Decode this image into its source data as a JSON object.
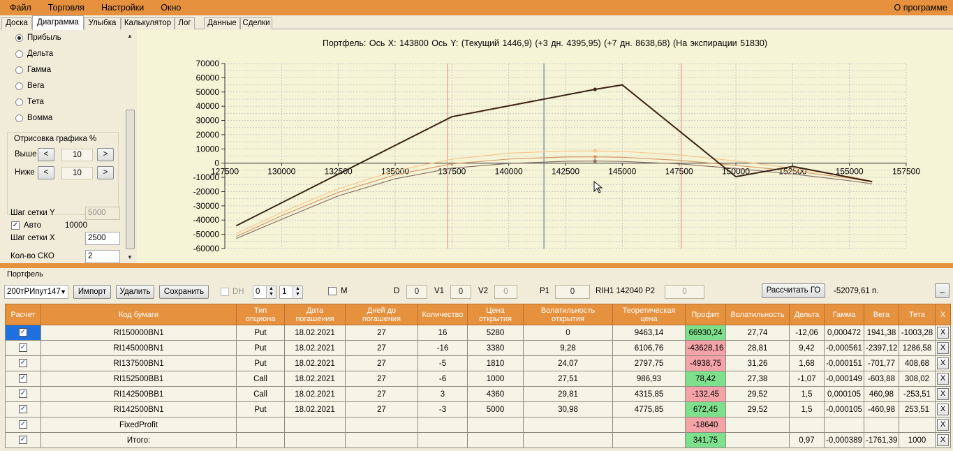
{
  "menu": {
    "items": [
      "Файл",
      "Торговля",
      "Настройки",
      "Окно"
    ],
    "about": "О программе"
  },
  "tabs": [
    "Доска",
    "Диаграмма",
    "Улыбка",
    "Калькулятор",
    "Лог",
    "Данные",
    "Сделки"
  ],
  "active_tab": "Диаграмма",
  "left_panel": {
    "radios": [
      {
        "label": "Прибыль",
        "checked": true
      },
      {
        "label": "Дельта",
        "checked": false
      },
      {
        "label": "Гамма",
        "checked": false
      },
      {
        "label": "Вега",
        "checked": false
      },
      {
        "label": "Тета",
        "checked": false
      },
      {
        "label": "Вомма",
        "checked": false
      }
    ],
    "plot_group": {
      "title": "Отрисовка графика %",
      "above_label": "Выше",
      "above_value": "10",
      "below_label": "Ниже",
      "below_value": "10",
      "dec": "<",
      "inc": ">"
    },
    "grid_y_label": "Шаг сетки Y",
    "grid_y_value": "5000",
    "auto_label": "Авто",
    "auto_checked": true,
    "auto_value": "10000",
    "grid_x_label": "Шаг сетки X",
    "grid_x_value": "2500",
    "sko_label": "Кол-во СКО",
    "sko_value": "2"
  },
  "chart_title": "Портфель: Ось X: 143800 Ось Y:  (Текущий 1446,9)  (+3 дн. 4395,95)  (+7 дн. 8638,68)  (На экспирации 51830)",
  "chart_data": {
    "type": "line",
    "xlim": [
      127500,
      157500
    ],
    "ylim": [
      -60000,
      70000
    ],
    "x_ticks": [
      127500,
      130000,
      132500,
      135000,
      137500,
      140000,
      142500,
      145000,
      147500,
      150000,
      152500,
      155000,
      157500
    ],
    "y_ticks": [
      70000,
      60000,
      50000,
      40000,
      30000,
      20000,
      10000,
      0,
      -10000,
      -20000,
      -30000,
      -40000,
      -50000,
      -60000
    ],
    "grid": true,
    "cursor_x": 143800,
    "current_price_line_x": 141550,
    "sigma_lines_x": [
      137300,
      147600
    ],
    "series": [
      {
        "color": "#3a2315",
        "width": 2,
        "x": [
          128000,
          137500,
          143800,
          145000,
          150000,
          152500,
          156000
        ],
        "y": [
          -44000,
          32600,
          51830,
          55000,
          -9500,
          -2300,
          -13000
        ],
        "marker_x": 143800,
        "marker_y": 51830
      },
      {
        "color": "#f5c890",
        "width": 1.2,
        "x": [
          128000,
          130000,
          132500,
          135000,
          137500,
          140000,
          142500,
          143800,
          145000,
          147500,
          150000,
          152500,
          155000,
          156000
        ],
        "y": [
          -49500,
          -34600,
          -17900,
          -5400,
          2800,
          7000,
          8550,
          8640,
          8300,
          5800,
          1500,
          -3500,
          -9500,
          -12600
        ],
        "marker_x": 143800,
        "marker_y": 8640
      },
      {
        "color": "#d49a6a",
        "width": 1.2,
        "x": [
          128000,
          130000,
          132500,
          135000,
          137500,
          140000,
          142500,
          143800,
          145000,
          147500,
          150000,
          152500,
          155000,
          156000
        ],
        "y": [
          -51500,
          -37000,
          -20500,
          -8200,
          -500,
          2900,
          4300,
          4400,
          4100,
          2000,
          -1500,
          -5500,
          -10500,
          -13300
        ],
        "marker_x": 143800,
        "marker_y": 4400
      },
      {
        "color": "#8a7268",
        "width": 1.2,
        "x": [
          128000,
          130000,
          132500,
          135000,
          137500,
          140000,
          142500,
          143800,
          145000,
          147500,
          150000,
          152500,
          155000,
          156000
        ],
        "y": [
          -53000,
          -39500,
          -23000,
          -11000,
          -3500,
          -200,
          1300,
          1450,
          1200,
          -500,
          -3800,
          -7600,
          -12300,
          -14500
        ],
        "marker_x": 143800,
        "marker_y": 1450
      }
    ]
  },
  "portfolio_label": "Портфель",
  "toolbar": {
    "portfolio_combo": "200тРИпут147",
    "import": "Импорт",
    "delete": "Удалить",
    "save": "Сохранить",
    "dh": "DH",
    "spin1": "0",
    "spin2": "1",
    "m": "M",
    "d_label": "D",
    "d_value": "0",
    "v1_label": "V1",
    "v1_value": "0",
    "v2_label": "V2",
    "v2_value": "0",
    "p1_label": "P1",
    "p1_value": "0",
    "rih": "RIH1 142040",
    "p2_label": "P2",
    "p2_value": "0",
    "calc_go": "Рассчитать ГО",
    "go_value": "-52079,61 п.",
    "minimize": "_"
  },
  "grid": {
    "headers": [
      "Расчет",
      "Код бумаги",
      "Тип опциона",
      "Дата погашения",
      "Дней до погашения",
      "Количество",
      "Цена открытия",
      "Волатильность открытия",
      "Теоретическая цена",
      "Профит",
      "Волатильность",
      "Дельта",
      "Гамма",
      "Вега",
      "Тета",
      "X"
    ],
    "rows": [
      {
        "calc": true,
        "code": "RI150000BN1",
        "type": "Put",
        "date": "18.02.2021",
        "days": "27",
        "qty": "16",
        "open_price": "5280",
        "open_vol": "0",
        "theo": "9463,14",
        "profit": "66930,24",
        "profit_sign": "pos",
        "vol": "27,74",
        "delta": "-12,06",
        "gamma": "0,000472",
        "vega": "1941,38",
        "theta": "-1003,28",
        "x": "X",
        "selected": true
      },
      {
        "calc": true,
        "code": "RI145000BN1",
        "type": "Put",
        "date": "18.02.2021",
        "days": "27",
        "qty": "-16",
        "open_price": "3380",
        "open_vol": "9,28",
        "theo": "6106,76",
        "profit": "-43628,16",
        "profit_sign": "neg",
        "vol": "28,81",
        "delta": "9,42",
        "gamma": "-0,000561",
        "vega": "-2397,12",
        "theta": "1286,58",
        "x": "X"
      },
      {
        "calc": true,
        "code": "RI137500BN1",
        "type": "Put",
        "date": "18.02.2021",
        "days": "27",
        "qty": "-5",
        "open_price": "1810",
        "open_vol": "24,07",
        "theo": "2797,75",
        "profit": "-4938,75",
        "profit_sign": "neg",
        "vol": "31,26",
        "delta": "1,68",
        "gamma": "-0,000151",
        "vega": "-701,77",
        "theta": "408,68",
        "x": "X"
      },
      {
        "calc": true,
        "code": "RI152500BB1",
        "type": "Call",
        "date": "18.02.2021",
        "days": "27",
        "qty": "-6",
        "open_price": "1000",
        "open_vol": "27,51",
        "theo": "986,93",
        "profit": "78,42",
        "profit_sign": "pos",
        "vol": "27,38",
        "delta": "-1,07",
        "gamma": "-0,000149",
        "vega": "-603,88",
        "theta": "308,02",
        "x": "X"
      },
      {
        "calc": true,
        "code": "RI142500BB1",
        "type": "Call",
        "date": "18.02.2021",
        "days": "27",
        "qty": "3",
        "open_price": "4360",
        "open_vol": "29,81",
        "theo": "4315,85",
        "profit": "-132,45",
        "profit_sign": "neg",
        "vol": "29,52",
        "delta": "1,5",
        "gamma": "0,000105",
        "vega": "460,98",
        "theta": "-253,51",
        "x": "X"
      },
      {
        "calc": true,
        "code": "RI142500BN1",
        "type": "Put",
        "date": "18.02.2021",
        "days": "27",
        "qty": "-3",
        "open_price": "5000",
        "open_vol": "30,98",
        "theo": "4775,85",
        "profit": "672,45",
        "profit_sign": "pos",
        "vol": "29,52",
        "delta": "1,5",
        "gamma": "-0,000105",
        "vega": "-460,98",
        "theta": "253,51",
        "x": "X"
      },
      {
        "calc": true,
        "code": "FixedProfit",
        "type": "",
        "date": "",
        "days": "",
        "qty": "",
        "open_price": "",
        "open_vol": "",
        "theo": "",
        "profit": "-18640",
        "profit_sign": "neg",
        "vol": "",
        "delta": "",
        "gamma": "",
        "vega": "",
        "theta": "",
        "x": "X"
      },
      {
        "calc": true,
        "code": "Итого:",
        "type": "",
        "date": "",
        "days": "",
        "qty": "",
        "open_price": "",
        "open_vol": "",
        "theo": "",
        "profit": "341,75",
        "profit_sign": "pos",
        "vol": "",
        "delta": "0,97",
        "gamma": "-0,000389",
        "vega": "-1761,39",
        "theta": "1000",
        "x": "X"
      }
    ]
  }
}
